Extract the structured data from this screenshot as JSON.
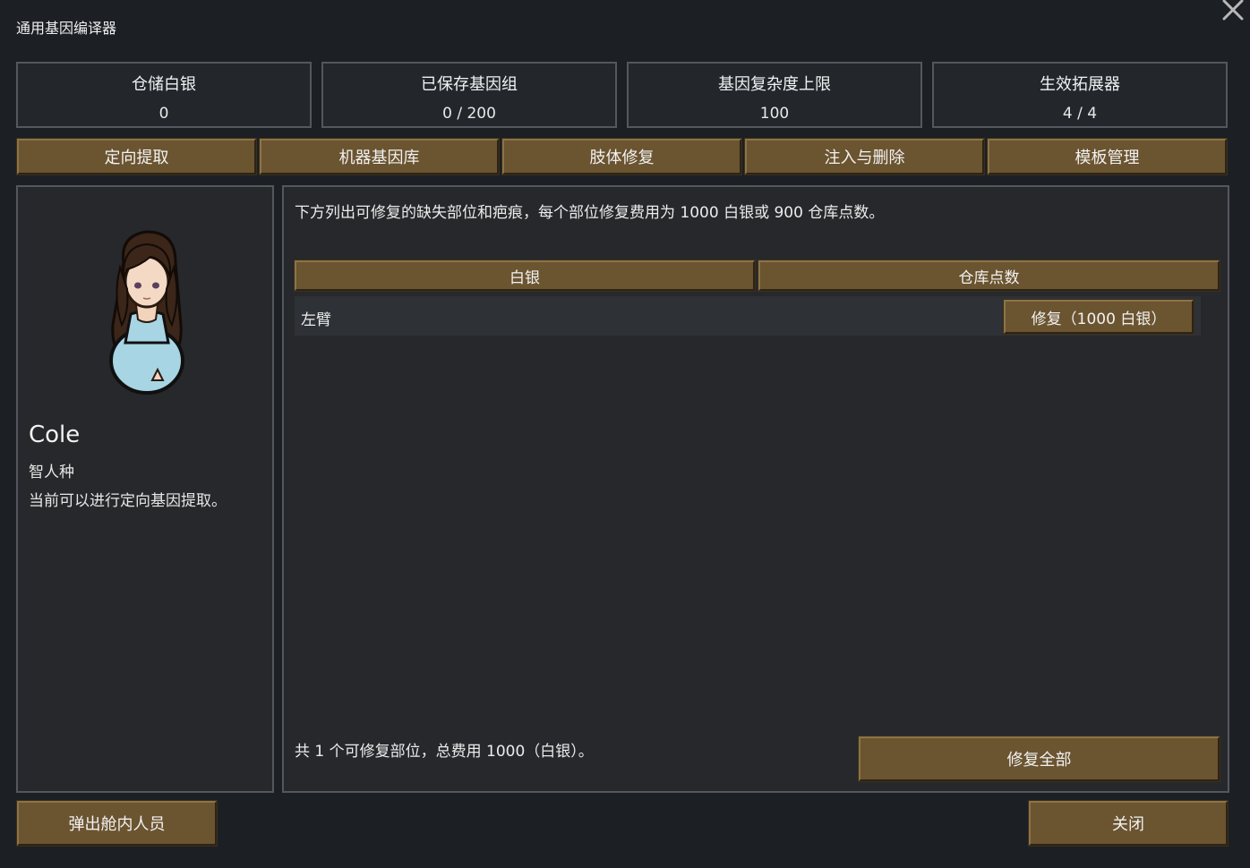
{
  "window": {
    "title": "通用基因编译器",
    "close_icon": "close-icon"
  },
  "stats": [
    {
      "label": "仓储白银",
      "value": "0"
    },
    {
      "label": "已保存基因组",
      "value": "0 / 200"
    },
    {
      "label": "基因复杂度上限",
      "value": "100"
    },
    {
      "label": "生效拓展器",
      "value": "4 / 4"
    }
  ],
  "tabs": [
    {
      "label": "定向提取"
    },
    {
      "label": "机器基因库"
    },
    {
      "label": "肢体修复"
    },
    {
      "label": "注入与删除"
    },
    {
      "label": "模板管理"
    }
  ],
  "pawn": {
    "name": "Cole",
    "race": "智人种",
    "status": "当前可以进行定向基因提取。"
  },
  "repair": {
    "description": "下方列出可修复的缺失部位和疤痕，每个部位修复费用为 1000 白银或 900 仓库点数。",
    "pay_silver_label": "白银",
    "pay_storage_label": "仓库点数",
    "items": [
      {
        "part": "左臂",
        "button": "修复（1000 白银）"
      }
    ],
    "summary": "共 1 个可修复部位，总费用 1000（白银）。",
    "repair_all_label": "修复全部"
  },
  "footer": {
    "eject_label": "弹出舱内人员",
    "close_label": "关闭"
  },
  "colors": {
    "button_fill": "#6b5430",
    "panel_bg": "#26282b",
    "window_bg": "#1c1f24",
    "border": "#54585e"
  }
}
